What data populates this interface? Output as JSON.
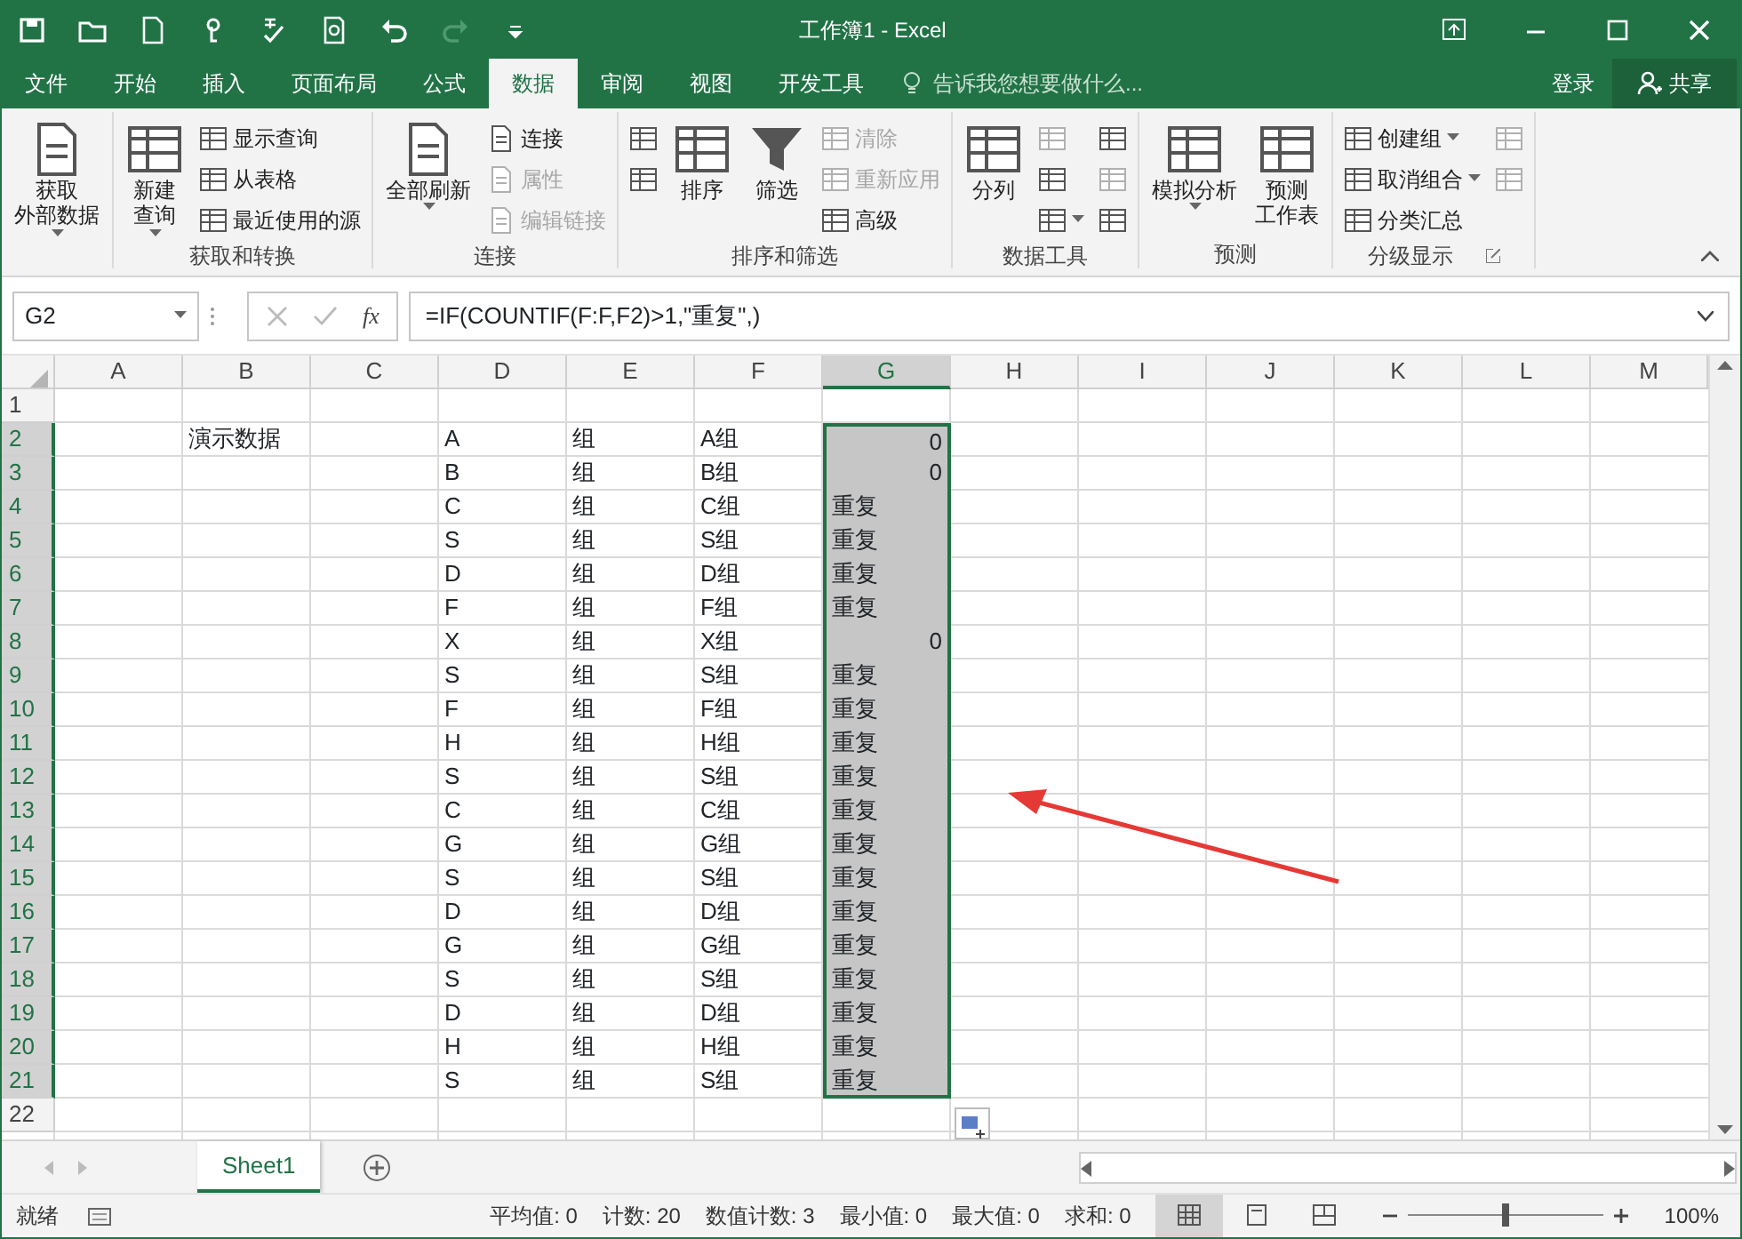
{
  "window": {
    "title": "工作簿1 - Excel"
  },
  "ribbon_tabs": [
    {
      "label": "文件",
      "selected": false
    },
    {
      "label": "开始",
      "selected": false
    },
    {
      "label": "插入",
      "selected": false
    },
    {
      "label": "页面布局",
      "selected": false
    },
    {
      "label": "公式",
      "selected": false
    },
    {
      "label": "数据",
      "selected": true
    },
    {
      "label": "审阅",
      "selected": false
    },
    {
      "label": "视图",
      "selected": false
    },
    {
      "label": "开发工具",
      "selected": false
    }
  ],
  "tell_me": {
    "placeholder": "告诉我您想要做什么..."
  },
  "sign_in": "登录",
  "share": "共享",
  "ribbon_groups": [
    {
      "columns": [
        [
          {
            "kind": "large",
            "lines": [
              "获取",
              "外部数据"
            ],
            "dropdown": true,
            "disabled": false
          }
        ]
      ]
    },
    {
      "label": "获取和转换",
      "columns": [
        [
          {
            "kind": "large",
            "lines": [
              "新建",
              "查询"
            ],
            "dropdown": true,
            "disabled": false
          }
        ],
        [
          {
            "kind": "small",
            "label": "显示查询",
            "dropdown": false,
            "disabled": false
          },
          {
            "kind": "small",
            "label": "从表格",
            "dropdown": false,
            "disabled": false
          },
          {
            "kind": "small",
            "label": "最近使用的源",
            "dropdown": false,
            "disabled": false
          }
        ]
      ]
    },
    {
      "label": "连接",
      "columns": [
        [
          {
            "kind": "large",
            "lines": [
              "全部刷新"
            ],
            "dropdown": true,
            "disabled": false
          }
        ],
        [
          {
            "kind": "small",
            "label": "连接",
            "dropdown": false,
            "disabled": false
          },
          {
            "kind": "small",
            "label": "属性",
            "dropdown": false,
            "disabled": true
          },
          {
            "kind": "small",
            "label": "编辑链接",
            "dropdown": false,
            "disabled": true
          }
        ]
      ]
    },
    {
      "label": "排序和筛选",
      "columns": [
        [
          {
            "kind": "small",
            "dropdown": false,
            "disabled": false
          },
          {
            "kind": "small",
            "dropdown": false,
            "disabled": false
          }
        ],
        [
          {
            "kind": "large",
            "lines": [
              "排序"
            ],
            "dropdown": false,
            "disabled": false
          }
        ],
        [
          {
            "kind": "large",
            "lines": [
              "筛选"
            ],
            "dropdown": false,
            "disabled": false
          }
        ],
        [
          {
            "kind": "small",
            "label": "清除",
            "dropdown": false,
            "disabled": true
          },
          {
            "kind": "small",
            "label": "重新应用",
            "dropdown": false,
            "disabled": true
          },
          {
            "kind": "small",
            "label": "高级",
            "dropdown": false,
            "disabled": false
          }
        ]
      ]
    },
    {
      "label": "数据工具",
      "columns": [
        [
          {
            "kind": "large",
            "lines": [
              "分列"
            ],
            "dropdown": false,
            "disabled": false
          }
        ],
        [
          {
            "kind": "small",
            "dropdown": false,
            "disabled": true
          },
          {
            "kind": "small",
            "dropdown": false,
            "disabled": false
          },
          {
            "kind": "small",
            "dropdown": true,
            "disabled": false
          }
        ],
        [
          {
            "kind": "small",
            "dropdown": false,
            "disabled": false
          },
          {
            "kind": "small",
            "dropdown": false,
            "disabled": true
          },
          {
            "kind": "small",
            "dropdown": false,
            "disabled": false
          }
        ]
      ]
    },
    {
      "label": "预测",
      "columns": [
        [
          {
            "kind": "large",
            "lines": [
              "模拟分析"
            ],
            "dropdown": true,
            "disabled": false
          }
        ],
        [
          {
            "kind": "large",
            "lines": [
              "预测",
              "工作表"
            ],
            "dropdown": false,
            "disabled": false
          }
        ]
      ]
    },
    {
      "label": "分级显示",
      "launcher": true,
      "columns": [
        [
          {
            "kind": "small",
            "label": "创建组",
            "dropdown": true,
            "disabled": false
          },
          {
            "kind": "small",
            "label": "取消组合",
            "dropdown": true,
            "disabled": false
          },
          {
            "kind": "small",
            "label": "分类汇总",
            "dropdown": false,
            "disabled": false
          }
        ],
        [
          {
            "kind": "small",
            "dropdown": false,
            "disabled": true
          },
          {
            "kind": "small",
            "dropdown": false,
            "disabled": true
          }
        ]
      ]
    }
  ],
  "formula_bar": {
    "name_box": "G2",
    "fx": "fx",
    "formula": "=IF(COUNTIF(F:F,F2)>1,\"重复\",)"
  },
  "columns": [
    {
      "label": "A",
      "selected": false
    },
    {
      "label": "B",
      "selected": false
    },
    {
      "label": "C",
      "selected": false
    },
    {
      "label": "D",
      "selected": false
    },
    {
      "label": "E",
      "selected": false
    },
    {
      "label": "F",
      "selected": false
    },
    {
      "label": "G",
      "selected": true
    },
    {
      "label": "H",
      "selected": false
    },
    {
      "label": "I",
      "selected": false
    },
    {
      "label": "J",
      "selected": false
    },
    {
      "label": "K",
      "selected": false
    },
    {
      "label": "L",
      "selected": false
    },
    {
      "label": "M",
      "selected": false
    }
  ],
  "rows": [
    {
      "header": "1",
      "selected": false,
      "values": {}
    },
    {
      "header": "2",
      "selected": true,
      "values": {
        "B": "演示数据",
        "D": "A",
        "E": "组",
        "F": "A组",
        "G": {
          "kind": "number",
          "text": "0"
        }
      }
    },
    {
      "header": "3",
      "selected": true,
      "values": {
        "D": "B",
        "E": "组",
        "F": "B组",
        "G": {
          "kind": "number",
          "text": "0"
        }
      }
    },
    {
      "header": "4",
      "selected": true,
      "values": {
        "D": "C",
        "E": "组",
        "F": "C组",
        "G": "重复"
      }
    },
    {
      "header": "5",
      "selected": true,
      "values": {
        "D": "S",
        "E": "组",
        "F": "S组",
        "G": "重复"
      }
    },
    {
      "header": "6",
      "selected": true,
      "values": {
        "D": "D",
        "E": "组",
        "F": "D组",
        "G": "重复"
      }
    },
    {
      "header": "7",
      "selected": true,
      "values": {
        "D": "F",
        "E": "组",
        "F": "F组",
        "G": "重复"
      }
    },
    {
      "header": "8",
      "selected": true,
      "values": {
        "D": "X",
        "E": "组",
        "F": "X组",
        "G": {
          "kind": "number",
          "text": "0"
        }
      }
    },
    {
      "header": "9",
      "selected": true,
      "values": {
        "D": "S",
        "E": "组",
        "F": "S组",
        "G": "重复"
      }
    },
    {
      "header": "10",
      "selected": true,
      "values": {
        "D": "F",
        "E": "组",
        "F": "F组",
        "G": "重复"
      }
    },
    {
      "header": "11",
      "selected": true,
      "values": {
        "D": "H",
        "E": "组",
        "F": "H组",
        "G": "重复"
      }
    },
    {
      "header": "12",
      "selected": true,
      "values": {
        "D": "S",
        "E": "组",
        "F": "S组",
        "G": "重复"
      }
    },
    {
      "header": "13",
      "selected": true,
      "values": {
        "D": "C",
        "E": "组",
        "F": "C组",
        "G": "重复"
      }
    },
    {
      "header": "14",
      "selected": true,
      "values": {
        "D": "G",
        "E": "组",
        "F": "G组",
        "G": "重复"
      }
    },
    {
      "header": "15",
      "selected": true,
      "values": {
        "D": "S",
        "E": "组",
        "F": "S组",
        "G": "重复"
      }
    },
    {
      "header": "16",
      "selected": true,
      "values": {
        "D": "D",
        "E": "组",
        "F": "D组",
        "G": "重复"
      }
    },
    {
      "header": "17",
      "selected": true,
      "values": {
        "D": "G",
        "E": "组",
        "F": "G组",
        "G": "重复"
      }
    },
    {
      "header": "18",
      "selected": true,
      "values": {
        "D": "S",
        "E": "组",
        "F": "S组",
        "G": "重复"
      }
    },
    {
      "header": "19",
      "selected": true,
      "values": {
        "D": "D",
        "E": "组",
        "F": "D组",
        "G": "重复"
      }
    },
    {
      "header": "20",
      "selected": true,
      "values": {
        "D": "H",
        "E": "组",
        "F": "H组",
        "G": "重复"
      }
    },
    {
      "header": "21",
      "selected": true,
      "values": {
        "D": "S",
        "E": "组",
        "F": "S组",
        "G": "重复"
      }
    },
    {
      "header": "22",
      "selected": false,
      "values": {}
    }
  ],
  "sheet_tabs": [
    {
      "label": "Sheet1",
      "selected": true
    }
  ],
  "status_bar": {
    "ready": "就绪",
    "stats": [
      "平均值: 0",
      "计数: 20",
      "数值计数: 3",
      "最小值: 0",
      "最大值: 0",
      "求和: 0"
    ],
    "views": [
      {
        "selected": true
      },
      {
        "selected": false
      },
      {
        "selected": false
      }
    ],
    "zoom": {
      "level": 0.5,
      "label": "100%"
    }
  }
}
